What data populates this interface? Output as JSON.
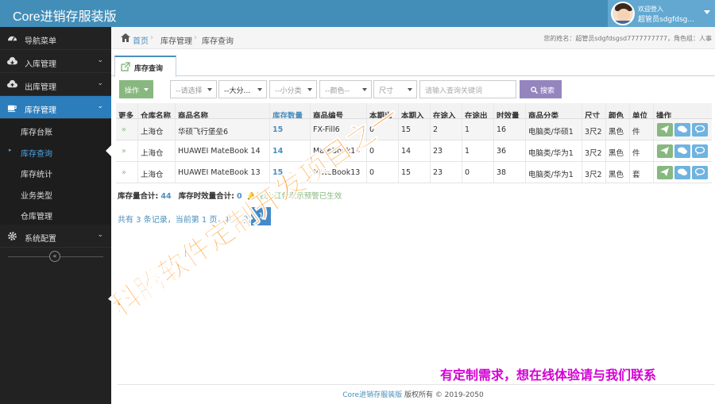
{
  "app": {
    "title": "Core进销存服装版"
  },
  "user": {
    "welcome": "欢迎登入",
    "name": "超管员sdgfdsg..."
  },
  "sidebar": {
    "items": [
      {
        "label": "导航菜单",
        "icon": "dashboard-icon"
      },
      {
        "label": "入库管理",
        "icon": "cloud-download-icon"
      },
      {
        "label": "出库管理",
        "icon": "cloud-upload-icon"
      },
      {
        "label": "库存管理",
        "icon": "coffee-icon"
      },
      {
        "label": "系统配置",
        "icon": "gear-icon"
      }
    ],
    "subitems": [
      "库存台账",
      "库存查询",
      "库存统计",
      "业务类型",
      "仓库管理"
    ],
    "collapse": "«"
  },
  "breadcrumb": {
    "home": "首页",
    "sep": "›",
    "stock": "库存管理",
    "query": "库存查询"
  },
  "user_info": "您的姓名：超管员sdgfdsgsd7777777777，角色组：人事",
  "tab": {
    "label": "库存查询"
  },
  "toolbar": {
    "ops": "操作",
    "store": "--请选择",
    "cat_big": "--大分...",
    "cat_small": "--小分类",
    "color": "--颜色--",
    "size": "尺寸",
    "search_placeholder": "请输入查询关键词",
    "search_btn": "搜索"
  },
  "table": {
    "headers": [
      "更多",
      "仓库名称",
      "商品名称",
      "库存数量",
      "商品编号",
      "本期出",
      "本期入",
      "在途入",
      "在途出",
      "时效量",
      "商品分类",
      "尺寸",
      "颜色",
      "单位",
      "操作"
    ],
    "rows": [
      [
        "»",
        "上海仓",
        "华硕飞行堡垒6",
        "15",
        "FX-Fill6",
        "0",
        "15",
        "2",
        "1",
        "16",
        "电脑类/华硕1",
        "3尺2",
        "黑色",
        "件"
      ],
      [
        "»",
        "上海仓",
        "HUAWEI MateBook 14",
        "14",
        "MateBook14",
        "0",
        "14",
        "23",
        "1",
        "36",
        "电脑类/华为1",
        "3尺2",
        "黑色",
        "件"
      ],
      [
        "»",
        "上海仓",
        "HUAWEI MateBook 13",
        "15",
        "MateBook13",
        "0",
        "15",
        "23",
        "0",
        "38",
        "电脑类/华为1",
        "3尺2",
        "黑色",
        "套"
      ]
    ]
  },
  "summary": {
    "total_label": "库存量合计:",
    "total": "44",
    "valid_label": "库存时效量合计:",
    "valid": "0",
    "tip": "提示:红色表示预警已生效"
  },
  "pager": {
    "text": "共有 3 条记录，当前第 1 页，共 1 页。",
    "page": "1"
  },
  "promo": "有定制需求，想在线体验请与我们联系",
  "watermark": "科腾软件定制开发项目之一",
  "footer": {
    "brand": "Core进销存服装版",
    "rest": " 版权所有 © 2019-2050"
  },
  "colors": {
    "topbar": "#438eb9",
    "sidebar": "#222222",
    "active": "#2b7dbc",
    "link": "#4c8fbd",
    "green": "#87b87f",
    "purple": "#9585bf",
    "promo": "#d400d4",
    "watermark": "#ff8800"
  }
}
